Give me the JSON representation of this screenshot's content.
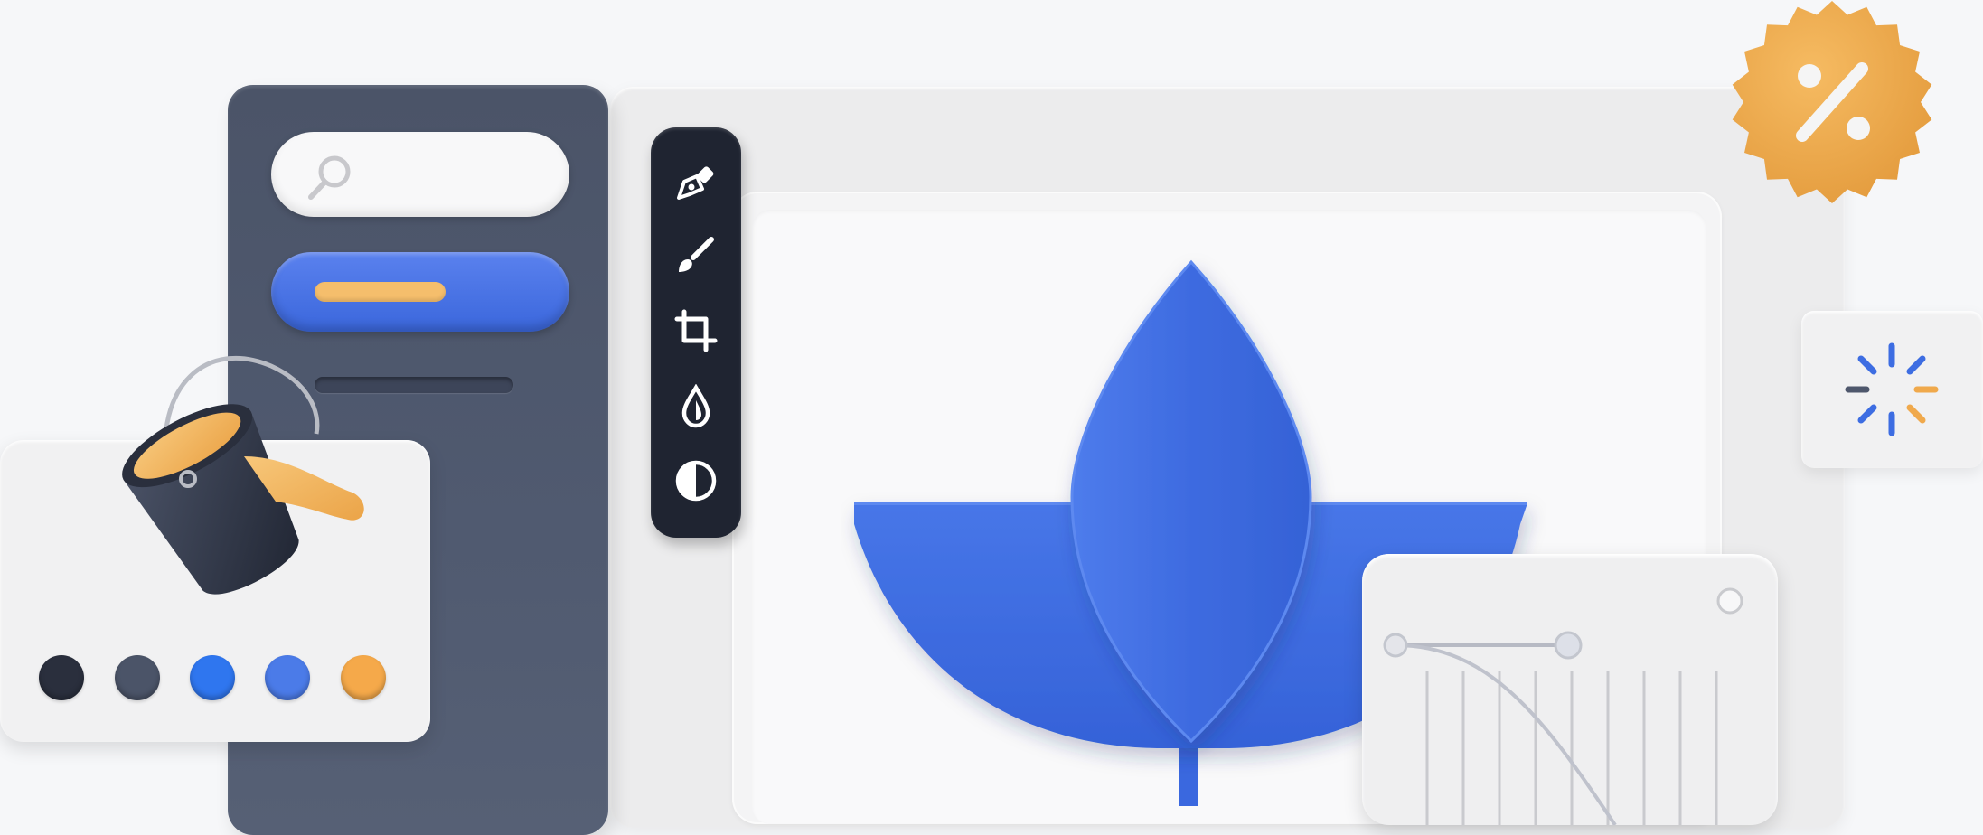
{
  "theme": {
    "panel": "#4e576c",
    "accent_blue": "#3b67dc",
    "accent_orange": "#f3a94b",
    "toolbar": "#1f2431"
  },
  "tools": [
    {
      "icon": "pen-nib-icon"
    },
    {
      "icon": "brush-icon"
    },
    {
      "icon": "crop-icon"
    },
    {
      "icon": "droplet-icon"
    },
    {
      "icon": "contrast-icon"
    }
  ],
  "swatches": [
    "#2a2f3d",
    "#4b5468",
    "#2f76ef",
    "#4b7be8",
    "#f5a94a"
  ],
  "badge": {
    "icon": "percent-icon",
    "color": "#f0a94c"
  },
  "loader": {
    "icon": "loading-spinner-icon"
  },
  "artwork": {
    "icon": "leaf-lotus-icon",
    "color": "#3d6de2"
  },
  "curves": {
    "icon": "curve-adjust-icon"
  }
}
